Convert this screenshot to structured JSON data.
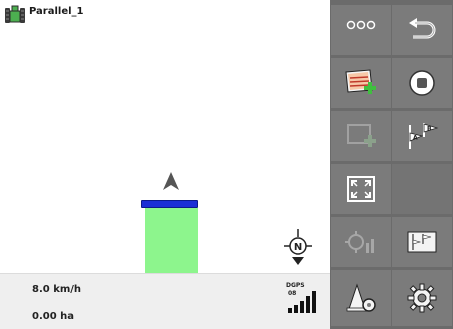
{
  "header": {
    "title": "Parallel_1",
    "vehicle_icon": "tractor-icon"
  },
  "status": {
    "speed": "8.0 km/h",
    "area": "0.00 ha",
    "gps_type": "DGPS",
    "gps_sats": "08",
    "signal_bars": 5
  },
  "colors": {
    "panel": "#6b6b6b",
    "button": "#7b7b7b",
    "worked_area": "#8df58d",
    "boom": "#1a2fd6",
    "status_bg": "#efefef"
  },
  "buttons": [
    {
      "name": "more-button",
      "icon": "more-dots-icon",
      "enabled": true
    },
    {
      "name": "back-button",
      "icon": "back-arrow-icon",
      "enabled": true
    },
    {
      "name": "add-field-boundary-button",
      "icon": "field-add-icon",
      "enabled": true
    },
    {
      "name": "record-button",
      "icon": "stop-circle-icon",
      "enabled": true
    },
    {
      "name": "add-headland-button",
      "icon": "headland-add-icon",
      "enabled": false
    },
    {
      "name": "set-ab-line-button",
      "icon": "ab-flag-icon",
      "enabled": true
    },
    {
      "name": "fullscreen-button",
      "icon": "expand-icon",
      "enabled": true
    },
    {
      "name": "empty-slot",
      "icon": "",
      "enabled": false
    },
    {
      "name": "calibrate-gps-button",
      "icon": "gps-drift-icon",
      "enabled": false
    },
    {
      "name": "guidance-lines-button",
      "icon": "ab-map-icon",
      "enabled": true
    },
    {
      "name": "machine-settings-button",
      "icon": "cone-gear-icon",
      "enabled": true
    },
    {
      "name": "settings-button",
      "icon": "gear-icon",
      "enabled": true
    }
  ]
}
